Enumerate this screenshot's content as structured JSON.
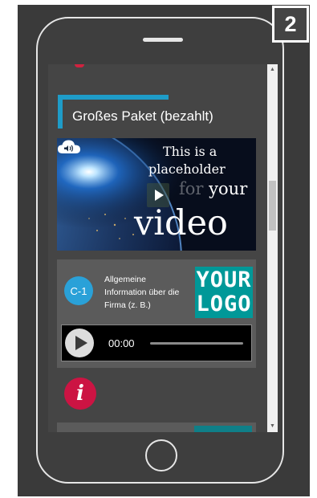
{
  "step_badge": "2",
  "package": {
    "title": "Großes Paket (bezahlt)"
  },
  "video": {
    "line1": "This is a",
    "line2": "placeholder",
    "line3_prefix": "for",
    "line3": "your",
    "line4": "video",
    "icons": {
      "play": "play-icon",
      "sound": "cloud-sound-icon"
    }
  },
  "card": {
    "badge": "C-1",
    "text": "Allgemeine Information über die Firma (z. B.)",
    "logo_line1": "YOUR",
    "logo_line2": "LOGO"
  },
  "audio": {
    "time": "00:00",
    "icons": {
      "play": "play-icon"
    }
  },
  "info_icon": "i",
  "scrollbar": {
    "up": "▲",
    "down": "▼"
  },
  "colors": {
    "accent_blue": "#1e9cc8",
    "logo_teal": "#009898",
    "info_red": "#cc1443",
    "badge_blue": "#2aa1d8"
  }
}
